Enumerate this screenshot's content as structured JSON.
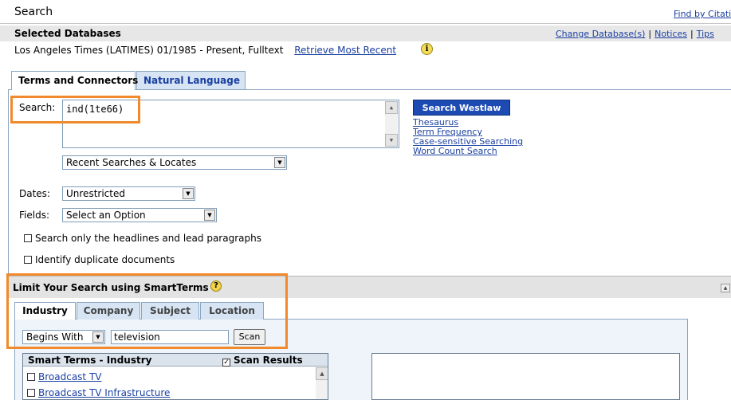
{
  "header": {
    "title": "Search",
    "find_by_citation": "Find by Citatio"
  },
  "selected_databases": {
    "label": "Selected Databases",
    "change_db": "Change Database(s)",
    "notices": "Notices",
    "tips": "Tips",
    "separator": "|",
    "db_line": "Los Angeles Times (LATIMES)   01/1985 - Present, Fulltext",
    "retrieve_most_recent": "Retrieve Most Recent",
    "info_glyph": "i"
  },
  "tabs": {
    "terms_and_connectors": "Terms and Connectors",
    "natural_language": "Natural Language"
  },
  "search": {
    "label": "Search:",
    "query": "ind(1te66)",
    "button": "Search Westlaw",
    "links": [
      "Thesaurus",
      "Term Frequency",
      "Case-sensitive Searching",
      "Word Count Search"
    ],
    "recent": "Recent Searches & Locates"
  },
  "filters": {
    "dates_label": "Dates:",
    "dates_value": "Unrestricted",
    "fields_label": "Fields:",
    "fields_value": "Select an Option",
    "headlines_check": "Search only the headlines and lead paragraphs",
    "duplicates_check": "Identify duplicate documents"
  },
  "smartterms": {
    "header": "Limit Your Search using SmartTerms",
    "help_glyph": "?",
    "tabs": [
      "Industry",
      "Company",
      "Subject",
      "Location"
    ],
    "active_tab": "Industry",
    "match_mode": "Begins With",
    "scan_input": "television",
    "scan_button": "Scan",
    "list_header": "Smart Terms - Industry",
    "scan_results": "Scan Results",
    "items": [
      "Broadcast TV",
      "Broadcast TV Infrastructure"
    ]
  },
  "colors": {
    "accent_orange": "#f08a2c",
    "link_blue": "#1a3fa0",
    "button_blue": "#1d4bb3",
    "tab_blue": "#d6e4f3"
  }
}
